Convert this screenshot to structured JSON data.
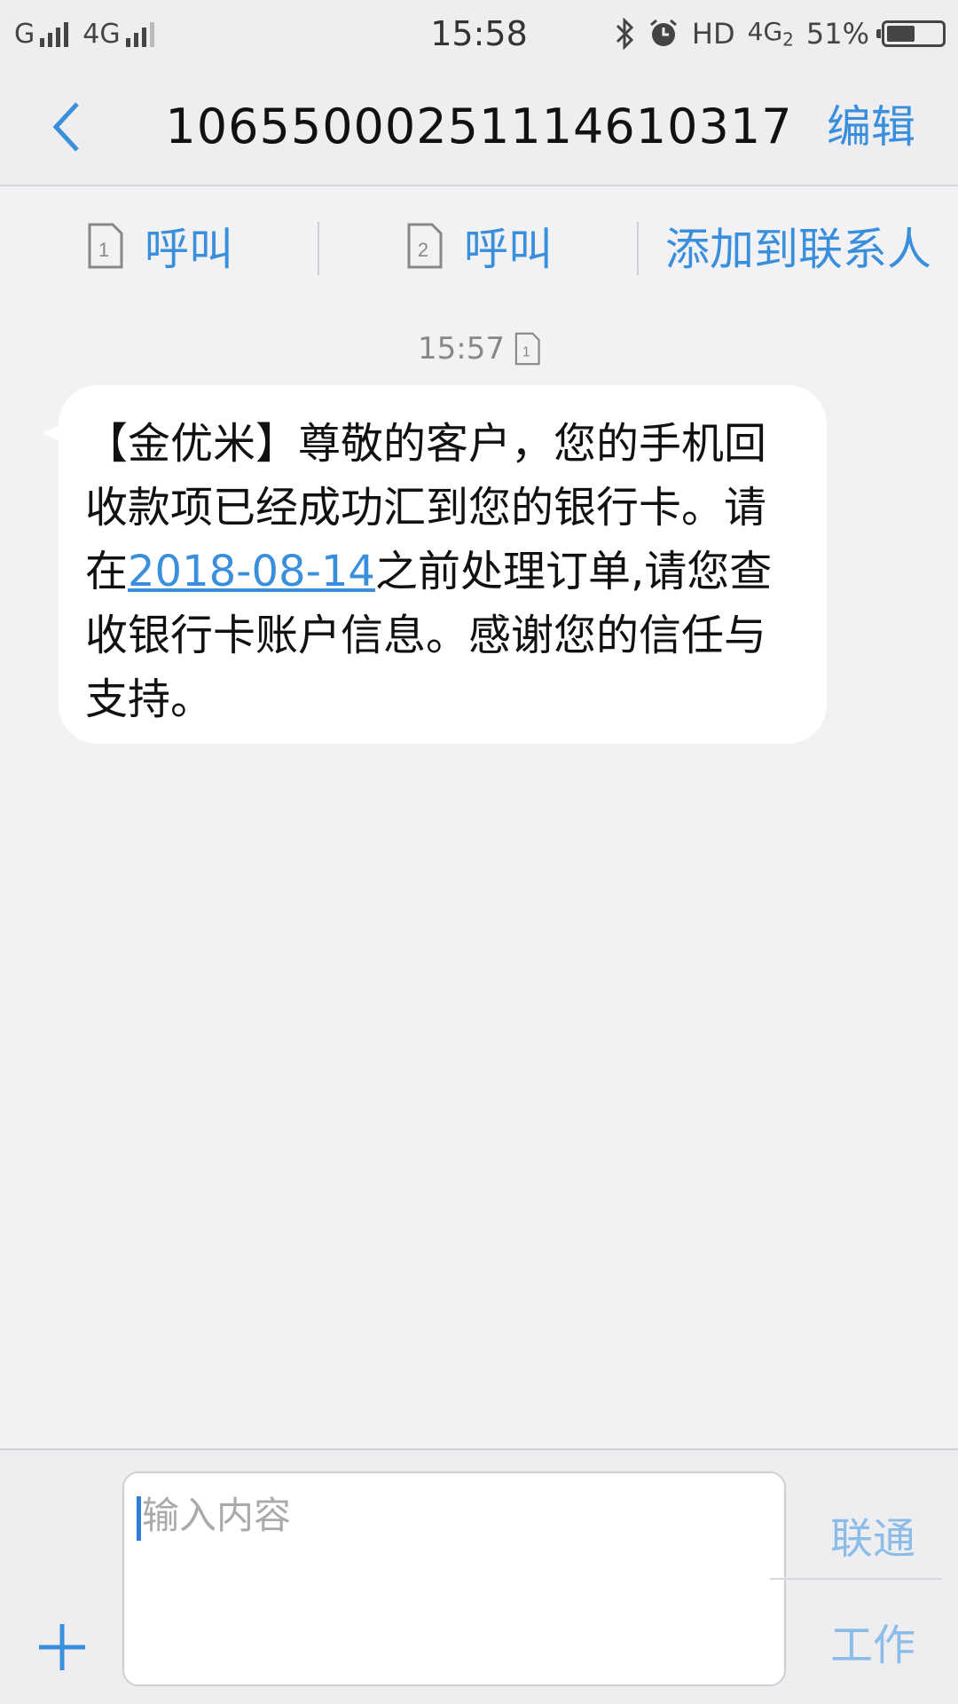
{
  "status_bar": {
    "carrier1": "G",
    "network": "4G",
    "time": "15:58",
    "hd": "HD",
    "network2": "4G",
    "network2_sub": "2",
    "battery": "51%",
    "battery_level": 0.51
  },
  "header": {
    "title": "10655000251114610317",
    "edit_label": "编辑"
  },
  "actions": {
    "sim1_number": "1",
    "sim1_label": "呼叫",
    "sim2_number": "2",
    "sim2_label": "呼叫",
    "add_contact_label": "添加到联系人"
  },
  "message": {
    "time": "15:57",
    "sim_number": "1",
    "text_before": "【金优米】尊敬的客户，您的手机回收款项已经成功汇到您的银行卡。请在",
    "date_link": "2018-08-14",
    "text_after": "之前处理订单,请您查收银行卡账户信息。感谢您的信任与支持。"
  },
  "composer": {
    "placeholder": "输入内容",
    "send_carrier_label": "联通",
    "send_work_label": "工作"
  },
  "colors": {
    "accent": "#3a8fdc",
    "background": "#f2f2f4",
    "bubble": "#ffffff"
  }
}
